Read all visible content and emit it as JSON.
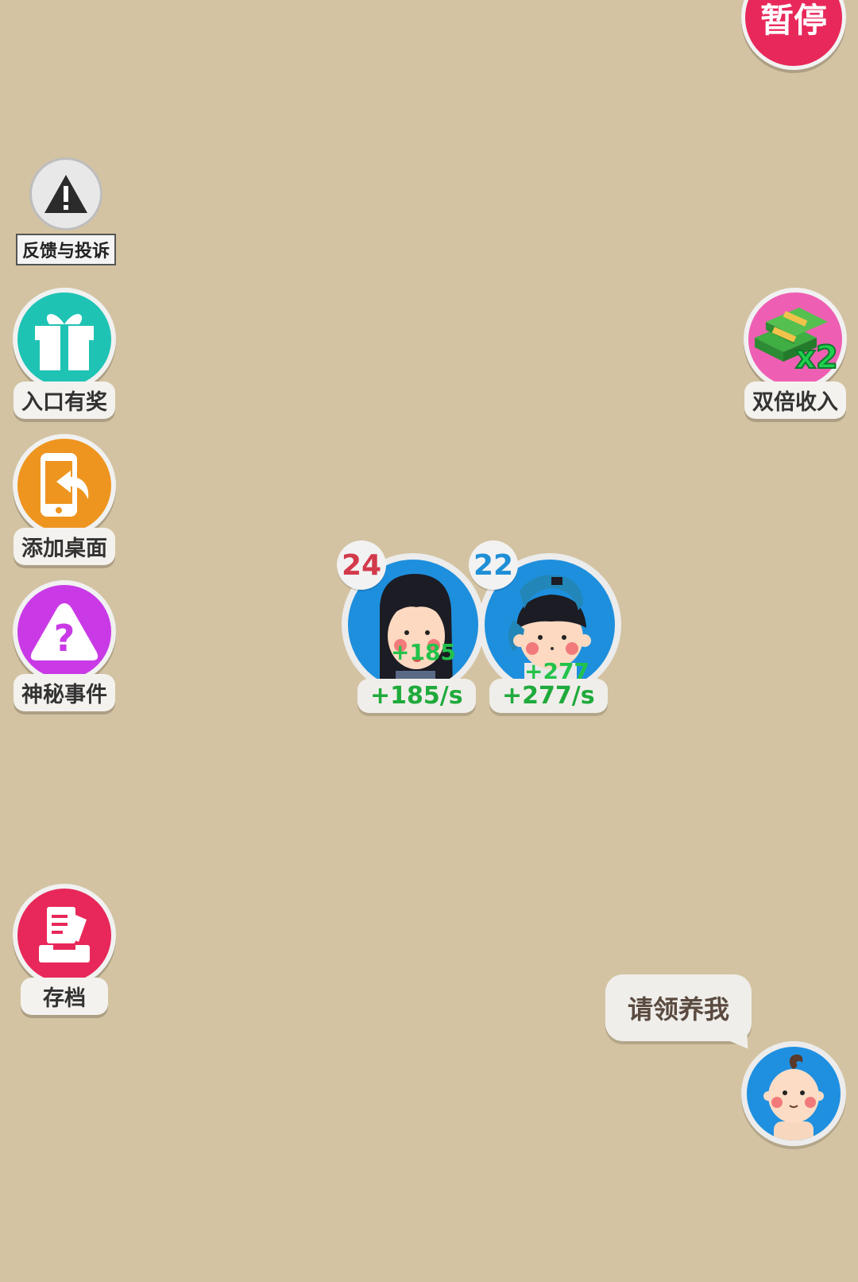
{
  "top_right": {
    "pause_label": "暂停"
  },
  "left_menu": {
    "feedback_label": "反馈与投诉",
    "items": [
      {
        "label": "入口有奖",
        "icon": "gift-icon",
        "color": "#1fc3b4"
      },
      {
        "label": "添加桌面",
        "icon": "phone-add-icon",
        "color": "#ee9520"
      },
      {
        "label": "神秘事件",
        "icon": "mystery-question-icon",
        "color": "#c93ae6"
      }
    ],
    "save": {
      "label": "存档",
      "icon": "save-document-icon",
      "color": "#e8285a"
    }
  },
  "right_menu": {
    "double_income": {
      "label": "双倍收入",
      "multiplier": "x2",
      "icon": "money-stack-icon"
    }
  },
  "characters": [
    {
      "level": "24",
      "level_color": "#d23a4b",
      "float_value": "+185",
      "rate": "+185/s"
    },
    {
      "level": "22",
      "level_color": "#1f8fd6",
      "float_value": "+277",
      "rate": "+277/s"
    }
  ],
  "adopt": {
    "bubble_text": "请领养我"
  }
}
